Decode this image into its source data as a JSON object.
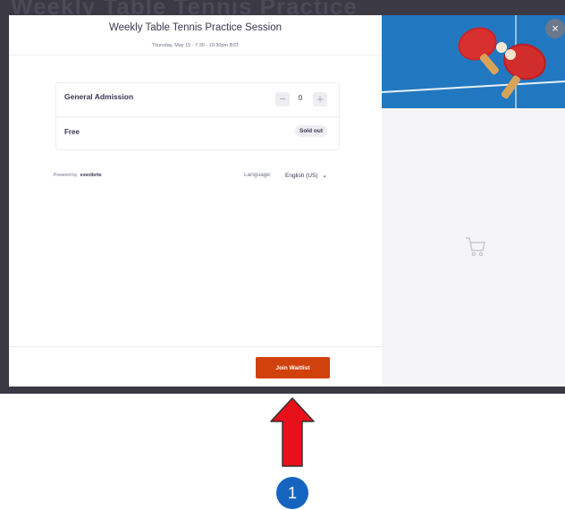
{
  "backdrop": {
    "text": "Weekly Table Tennis Practice"
  },
  "modal": {
    "title": "Weekly Table Tennis Practice Session",
    "subtitle": "Thursday, May 15 · 7:30 - 10:30pm BST",
    "tickets": [
      {
        "name": "General Admission",
        "quantity": "0",
        "minus": "−",
        "plus": "+"
      },
      {
        "price": "Free",
        "status": "Sold out"
      }
    ],
    "powered_by": {
      "label": "Powered by",
      "brand": "eventbrite"
    },
    "language": {
      "label": "Language:",
      "value": "English (US)"
    },
    "join_button": "Join Waitlist",
    "close_label": "×"
  },
  "annotation": {
    "step": "1"
  },
  "colors": {
    "accent": "#d1410c",
    "backdrop": "#3a3944",
    "badge": "#1565c0",
    "arrow": "#e8101a"
  },
  "icons": [
    "close-icon",
    "cart-icon",
    "chevron-down-icon",
    "eventbrite-logo-icon"
  ]
}
